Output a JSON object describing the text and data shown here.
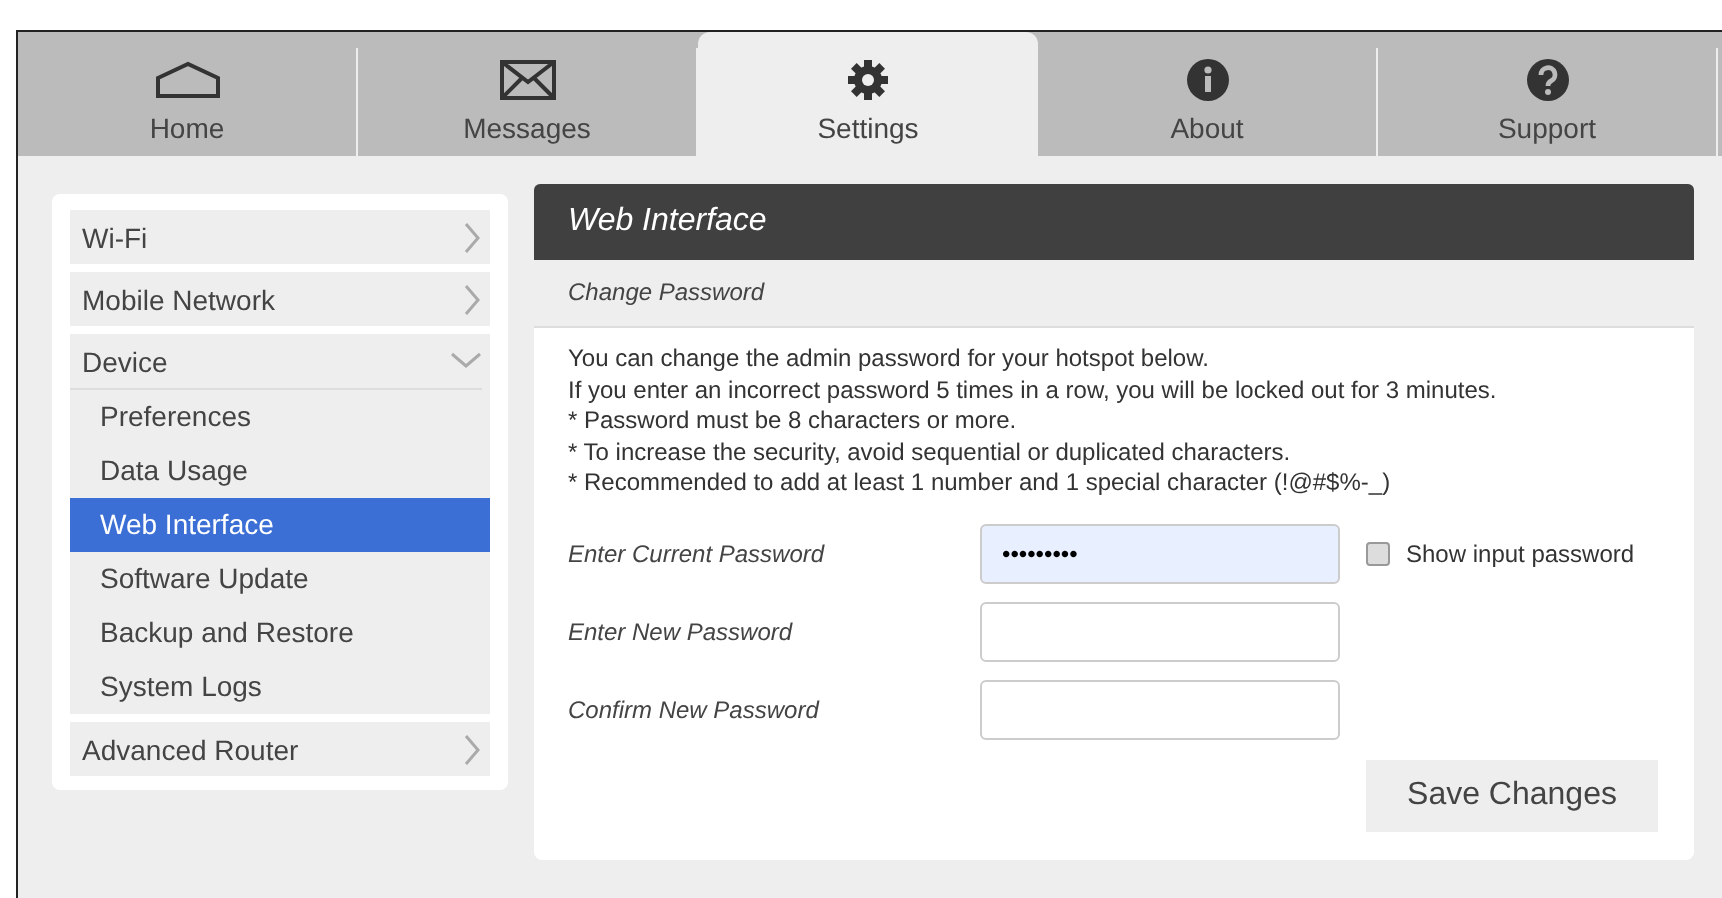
{
  "tabs": [
    {
      "label": "Home",
      "kind": "home",
      "selected": false
    },
    {
      "label": "Messages",
      "kind": "mail",
      "selected": false
    },
    {
      "label": "Settings",
      "kind": "gear",
      "selected": true
    },
    {
      "label": "About",
      "kind": "info",
      "selected": false
    },
    {
      "label": "Support",
      "kind": "help",
      "selected": false
    }
  ],
  "sidebar": {
    "items": [
      {
        "label": "Wi-Fi",
        "expanded": false
      },
      {
        "label": "Mobile Network",
        "expanded": false
      },
      {
        "label": "Device",
        "expanded": true,
        "children": [
          {
            "label": "Preferences",
            "selected": false
          },
          {
            "label": "Data Usage",
            "selected": false
          },
          {
            "label": "Web Interface",
            "selected": true
          },
          {
            "label": "Software Update",
            "selected": false
          },
          {
            "label": "Backup and Restore",
            "selected": false
          },
          {
            "label": "System Logs",
            "selected": false
          }
        ]
      },
      {
        "label": "Advanced Router",
        "expanded": false
      }
    ]
  },
  "panel": {
    "title": "Web Interface",
    "subtitle": "Change Password",
    "intro": [
      "You can change the admin password for your hotspot below.",
      "If you enter an incorrect password 5 times in a row, you will be locked out for 3 minutes.",
      "* Password must be 8 characters or more.",
      "* To increase the security, avoid sequential or duplicated characters.",
      "* Recommended to add at least 1 number and 1 special character (!@#$%-_)"
    ],
    "fields": [
      {
        "label": "Enter Current Password",
        "value": "•••••••••",
        "focused": true
      },
      {
        "label": "Enter New Password",
        "focused": false
      },
      {
        "label": "Confirm New Password",
        "focused": false
      }
    ],
    "show_password": {
      "label": "Show input password",
      "checked": false
    },
    "save_button": "Save Changes"
  }
}
